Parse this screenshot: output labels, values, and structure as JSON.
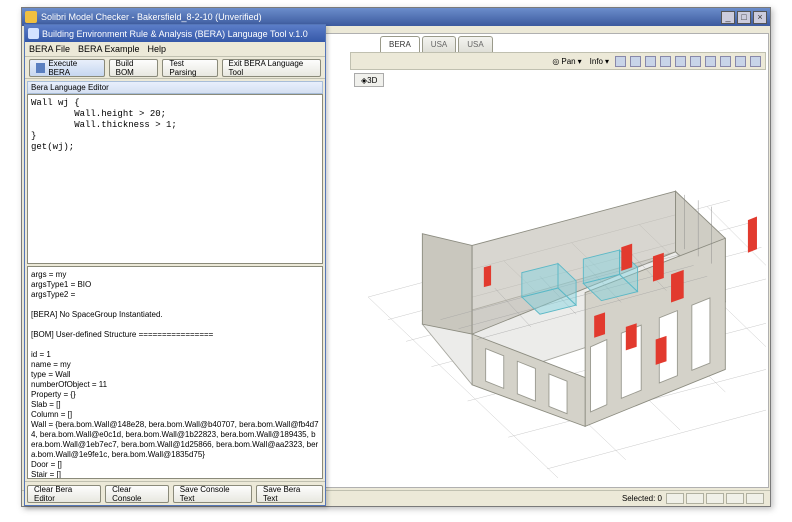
{
  "outer": {
    "title": "Solibri Model Checker - Bakersfield_8-2-10 (Unverified)"
  },
  "bera": {
    "title": "Building Environment Rule & Analysis (BERA) Language Tool v.1.0",
    "menu": {
      "file": "BERA File",
      "example": "BERA Example",
      "help": "Help"
    },
    "buttons": {
      "execute": "Execute BERA",
      "buildBom": "Build BOM",
      "testParsing": "Test Parsing",
      "exit": "Exit BERA Language Tool"
    },
    "editorLabel": "Bera Language Editor",
    "code": "Wall wj {\n        Wall.height > 20;\n        Wall.thickness > 1;\n}\nget(wj);",
    "output": "args = my\nargsType1 = BIO\nargsType2 =\n\n[BERA] No SpaceGroup Instantiated.\n\n[BOM] User-defined Structure ================\n\nid = 1\nname = my\ntype = Wall\nnumberOfObject = 11\nProperty = {}\nSlab = []\nColumn = []\nWall = {bera.bom.Wall@148e28, bera.bom.Wall@b40707, bera.bom.Wall@fb4d74, bera.bom.Wall@e0c1d, bera.bom.Wall@1b22823, bera.bom.Wall@189435, bera.bom.Wall@1eb7ec7, bera.bom.Wall@1d25866, bera.bom.Wall@aa2323, bera.bom.Wall@1e9fe1c, bera.bom.Wall@1835d75}\nDoor = []\nStair = []\nRamp = []\nWindow = []\n\n[BERA] No PathDef.\n\n[BERA] Runner initiated.\n\n[BERA] Language Execution # 1 ==========\ncommand = get, args = my",
    "bottom": {
      "clearEditor": "Clear Bera Editor",
      "clearConsole": "Clear Console",
      "saveConsole": "Save Console Text",
      "saveBera": "Save Bera Text"
    }
  },
  "tabs": {
    "t1": "BERA",
    "t2": "USA",
    "t3": "USA"
  },
  "toolbar": {
    "pan": "Pan",
    "info": "Info"
  },
  "viewport": {
    "tab": "3D"
  },
  "status": {
    "selected": "Selected: 0"
  }
}
